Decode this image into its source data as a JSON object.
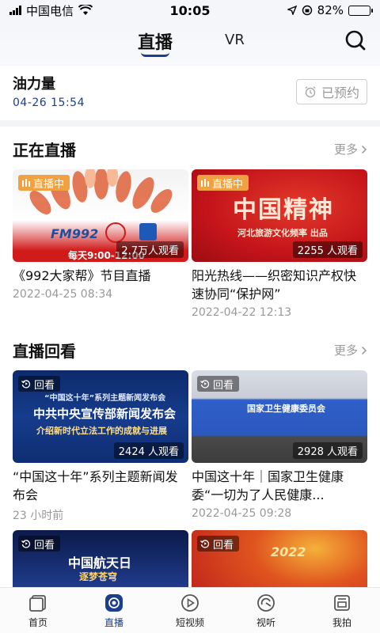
{
  "status_bar": {
    "carrier": "中国电信",
    "time": "10:05",
    "battery": "82%",
    "battery_level": 0.82
  },
  "top_nav": {
    "tabs": [
      {
        "label": "直播",
        "active": true
      },
      {
        "label": "VR",
        "active": false
      }
    ],
    "search_icon": "search-icon"
  },
  "reserved": {
    "title": "油力量",
    "time": "04-26 15:54",
    "button_label": "已预约",
    "button_icon": "alarm-clock-icon"
  },
  "live_now": {
    "title": "正在直播",
    "more_label": "更多",
    "items": [
      {
        "badge": "直播中",
        "viewers": "2.7万人观看",
        "title": "《992大家帮》节目直播",
        "date": "2022-04-25 08:34",
        "thumb_text": [
          "FM992",
          "每天9:00-12:00"
        ]
      },
      {
        "badge": "直播中",
        "viewers": "2255 人观看",
        "title": "阳光热线——织密知识产权快速协同“保护网”",
        "date": "2022-04-22 12:13",
        "thumb_text": [
          "中国精神",
          "河北旅游文化频率 出品"
        ]
      }
    ]
  },
  "replay": {
    "title": "直播回看",
    "more_label": "更多",
    "items": [
      {
        "badge": "回看",
        "viewers": "2424 人观看",
        "title": "“中国这十年”系列主题新闻发布会",
        "date": "23 小时前",
        "thumb_text": [
          "“中国这十年”系列主题新闻发布会",
          "中共中央宣传部新闻发布会",
          "介绍新时代立法工作的成就与进展"
        ]
      },
      {
        "badge": "回看",
        "viewers": "2928 人观看",
        "title": "中国这十年｜国家卫生健康委“一切为了人民健康...",
        "date": "2022-04-25 09:28",
        "thumb_text": [
          "国家卫生健康委员会"
        ]
      },
      {
        "badge": "回看",
        "viewers": "",
        "title": "",
        "date": "",
        "thumb_text": [
          "中国航天日",
          "逐梦苍穹"
        ]
      },
      {
        "badge": "回看",
        "viewers": "",
        "title": "",
        "date": "",
        "thumb_text": [
          "2022"
        ]
      }
    ]
  },
  "bottom_bar": {
    "items": [
      {
        "label": "首页",
        "icon": "home-icon",
        "active": false
      },
      {
        "label": "直播",
        "icon": "live-icon",
        "active": true
      },
      {
        "label": "短视频",
        "icon": "play-icon",
        "active": false
      },
      {
        "label": "视听",
        "icon": "listen-icon",
        "active": false
      },
      {
        "label": "我拍",
        "icon": "camera-icon",
        "active": false
      }
    ]
  },
  "colors": {
    "accent": "#1c3e8f",
    "live_badge": "#f0a243",
    "muted": "#999999"
  }
}
